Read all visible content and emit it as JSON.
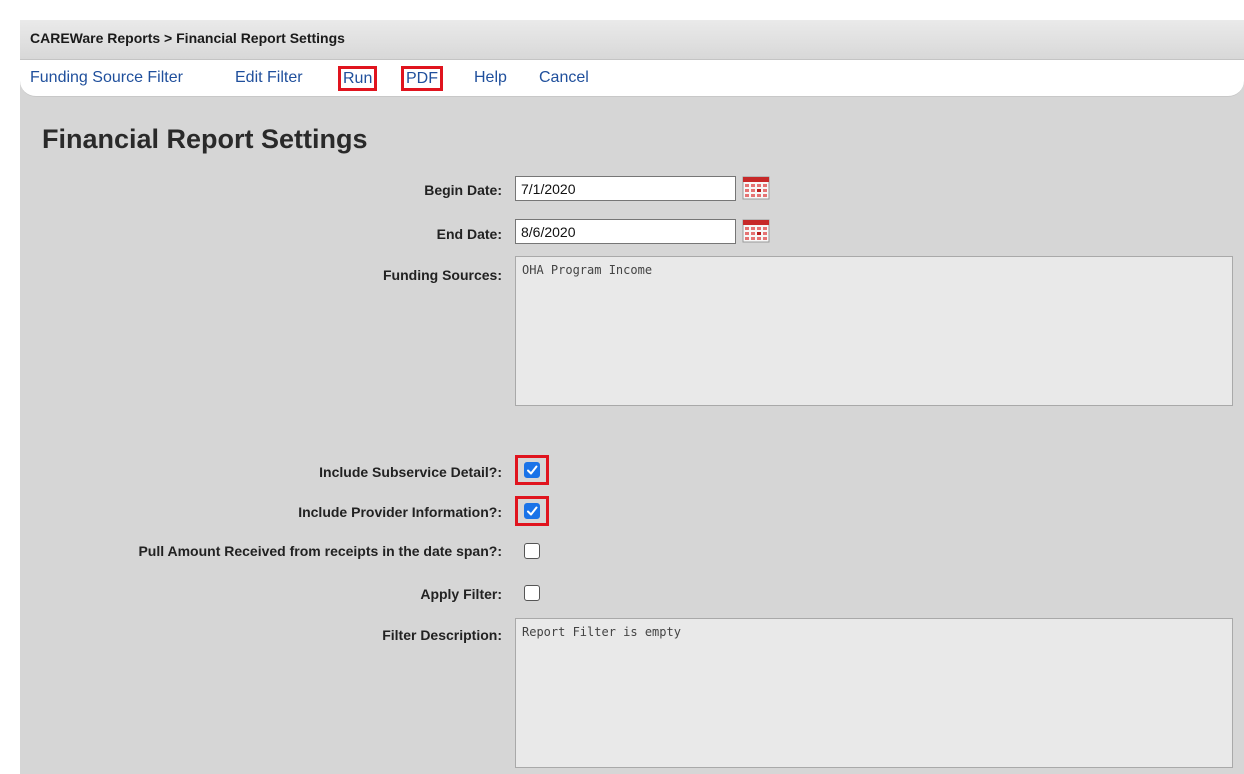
{
  "breadcrumb": "CAREWare Reports > Financial Report Settings",
  "menu": {
    "funding_source_filter": "Funding Source Filter",
    "edit_filter": "Edit Filter",
    "run": "Run",
    "pdf": "PDF",
    "help": "Help",
    "cancel": "Cancel"
  },
  "page_title": "Financial Report Settings",
  "form": {
    "begin_date_label": "Begin Date:",
    "begin_date_value": "7/1/2020",
    "end_date_label": "End Date:",
    "end_date_value": "8/6/2020",
    "funding_sources_label": "Funding Sources:",
    "funding_sources_value": "OHA Program Income",
    "include_subservice_label": "Include Subservice Detail?:",
    "include_subservice_checked": true,
    "include_provider_label": "Include Provider Information?:",
    "include_provider_checked": true,
    "pull_amount_label": "Pull Amount Received from receipts in the date span?:",
    "pull_amount_checked": false,
    "apply_filter_label": "Apply Filter:",
    "apply_filter_checked": false,
    "filter_description_label": "Filter Description:",
    "filter_description_value": "Report Filter is empty"
  },
  "icons": {
    "calendar": "calendar-icon",
    "check": "checkmark-icon"
  },
  "colors": {
    "link": "#1f4f9c",
    "highlight_box": "#e0141e",
    "checkbox_checked": "#1a73e8",
    "background": "#d6d6d6"
  }
}
